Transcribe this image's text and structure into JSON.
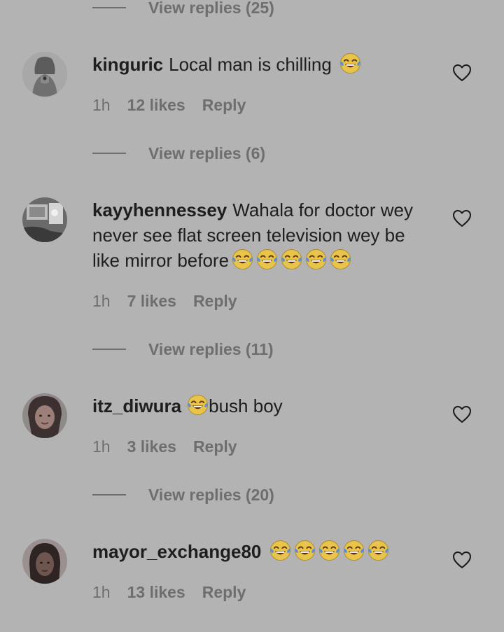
{
  "top_replies": {
    "label": "View replies (25)"
  },
  "comments": [
    {
      "username": "kinguric",
      "text": "Local man is chilling",
      "emoji_count": 1,
      "emoji": "face-with-tears-of-joy",
      "time": "1h",
      "likes": "12 likes",
      "reply_label": "Reply",
      "view_replies": "View replies (6)"
    },
    {
      "username": "kayyhennessey",
      "text": "Wahala for doctor wey never see flat screen television wey be like mirror before",
      "emoji_count": 5,
      "emoji": "face-with-tears-of-joy",
      "time": "1h",
      "likes": "7 likes",
      "reply_label": "Reply",
      "view_replies": "View replies (11)"
    },
    {
      "username": "itz_diwura",
      "text_before_emoji": "",
      "emoji_count": 1,
      "emoji": "face-with-tears-of-joy",
      "text_after_emoji": "bush boy",
      "time": "1h",
      "likes": "3 likes",
      "reply_label": "Reply",
      "view_replies": "View replies (20)"
    },
    {
      "username": "mayor_exchange80",
      "text": "",
      "emoji_count": 5,
      "emoji": "face-with-tears-of-joy",
      "time": "1h",
      "likes": "13 likes",
      "reply_label": "Reply"
    }
  ],
  "icons": {
    "like": "heart-icon",
    "avatar": "avatar"
  },
  "colors": {
    "background": "#b3b3b3",
    "text": "#1e1e1e",
    "muted": "#6e6e6e"
  }
}
